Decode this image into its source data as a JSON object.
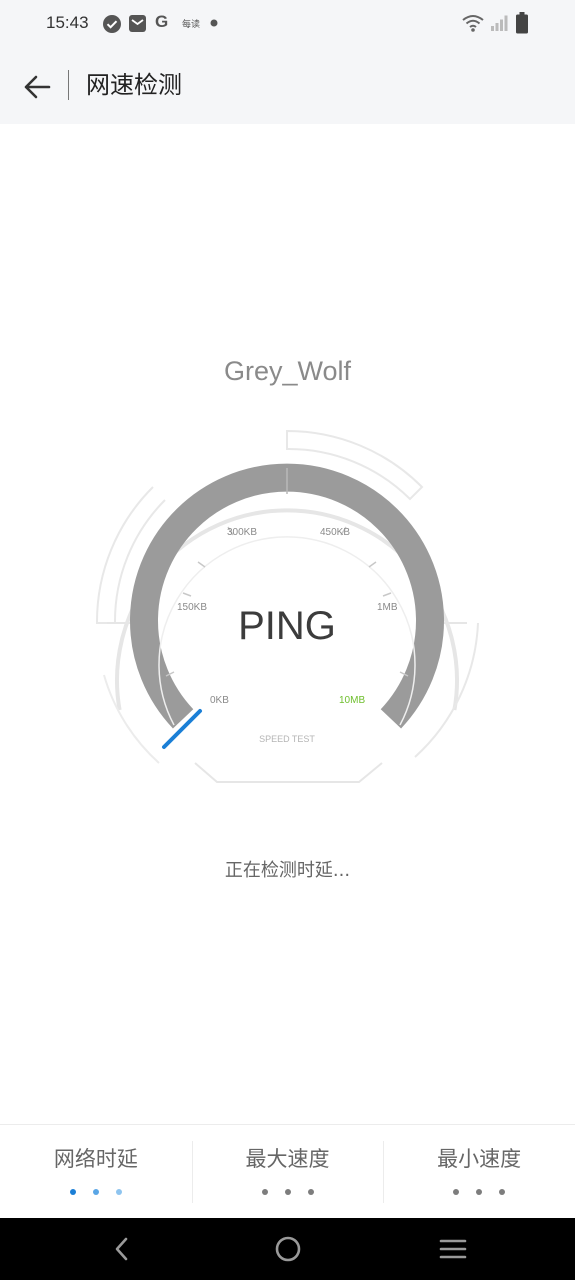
{
  "status_bar": {
    "time": "15:43",
    "notification_icons": [
      "check-circle-icon",
      "mail-icon",
      "google-icon",
      "app-badge-icon",
      "dot-icon"
    ],
    "g_letter": "G",
    "badge_text": "每读",
    "right_icons": [
      "wifi-icon",
      "signal-icon",
      "battery-icon"
    ]
  },
  "header": {
    "back_icon": "arrow-left-icon",
    "title": "网速检测"
  },
  "network_name": "Grey_Wolf",
  "gauge": {
    "center_label": "PING",
    "tick_labels": [
      "0KB",
      "150KB",
      "300KB",
      "450KB",
      "1MB",
      "10MB"
    ],
    "caption": "SPEED TEST",
    "needle_value": "0KB",
    "colors": {
      "arc": "#9b9b9b",
      "needle": "#1b7fd6",
      "highlight_label": "#6fbf2e",
      "outer_lines": "#e6e6e6"
    }
  },
  "status_text": "正在检测时延...",
  "tabs": [
    {
      "label": "网络时延",
      "active": true,
      "dot_colors": [
        "#1b7fd6",
        "#5aa6e6",
        "#8ec4ef"
      ]
    },
    {
      "label": "最大速度",
      "active": false,
      "dot_colors": [
        "#7d7d7d",
        "#7d7d7d",
        "#7d7d7d"
      ]
    },
    {
      "label": "最小速度",
      "active": false,
      "dot_colors": [
        "#7d7d7d",
        "#7d7d7d",
        "#7d7d7d"
      ]
    }
  ],
  "nav_bar": {
    "icons": [
      "back-nav-icon",
      "home-nav-icon",
      "recents-nav-icon"
    ]
  }
}
